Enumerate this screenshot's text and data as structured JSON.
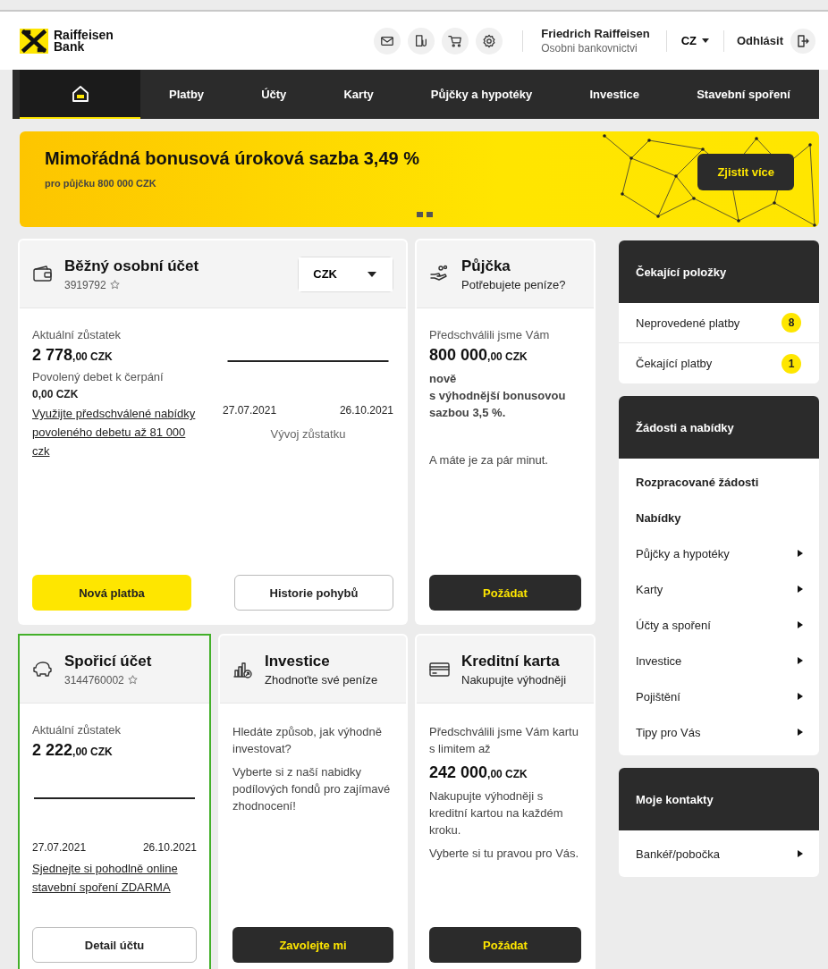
{
  "header": {
    "logo": {
      "line1": "Raiffeisen",
      "line2": "Bank"
    },
    "tools": [
      {
        "kind": "mail"
      },
      {
        "kind": "document"
      },
      {
        "kind": "cart"
      },
      {
        "kind": "settings"
      }
    ],
    "user": {
      "name": "Friedrich Raiffeisen",
      "subtitle": "Osobni bankovnictvi"
    },
    "language": "CZ",
    "logout": "Odhlásit"
  },
  "nav": [
    {
      "kind": "home",
      "selected": true
    },
    {
      "kind": "link",
      "label": "Platby",
      "selected": false
    },
    {
      "kind": "link",
      "label": "Účty",
      "selected": false
    },
    {
      "kind": "link",
      "label": "Karty",
      "selected": false
    },
    {
      "kind": "link",
      "label": "Půjčky a hypotéky",
      "selected": false
    },
    {
      "kind": "link",
      "label": "Investice",
      "selected": false
    },
    {
      "kind": "link",
      "label": "Stavební spoření",
      "selected": false
    }
  ],
  "banner": {
    "title": "Mimořádná bonusová úroková sazba 3,49 %",
    "subtitle": "pro půjčku 800 000 CZK",
    "button": "Zjistit více"
  },
  "cards": [
    {
      "kind": "wide",
      "title": "Běžný osobní účet",
      "number": "3919792",
      "favorite": false,
      "currency": "CZK",
      "selected": false,
      "columns": [
        [
          {
            "kind": "label",
            "text": "Aktuální zůstatek"
          },
          {
            "kind": "amount",
            "main": "2 778",
            "decimals": ",00 CZK"
          },
          {
            "kind": "label",
            "text": "Povolený debet k čerpání"
          },
          {
            "kind": "value",
            "text": "0,00 CZK"
          },
          {
            "kind": "link",
            "text": "Využijte předschválené nabídky povoleného debetu až 81 000 czk"
          }
        ],
        [
          {
            "kind": "chart",
            "start": "27.07.2021",
            "end": "26.10.2021",
            "caption": "Vývoj zůstatku"
          }
        ]
      ],
      "buttons": [
        {
          "kind": "primary",
          "label": "Nová platba"
        },
        {
          "kind": "outline",
          "label": "Historie pohybů"
        }
      ]
    },
    {
      "kind": "narrow",
      "title": "Půjčka",
      "subtitle": "Potřebujete peníze?",
      "selected": false,
      "blocks": [
        {
          "kind": "label",
          "text": "Předschválili jsme Vám"
        },
        {
          "kind": "amount",
          "main": "800 000",
          "decimals": ",00 CZK"
        },
        {
          "kind": "bold",
          "text": "nově"
        },
        {
          "kind": "bold",
          "text": "s výhodnější bonusovou sazbou 3,5 %."
        },
        {
          "kind": "gap"
        },
        {
          "kind": "text",
          "text": "A máte je za pár minut."
        }
      ],
      "buttons": [
        {
          "kind": "dark",
          "label": "Požádat"
        }
      ]
    },
    {
      "kind": "narrow",
      "title": "Spořicí účet",
      "number": "3144760002",
      "favorite": false,
      "selected": true,
      "blocks": [
        {
          "kind": "label",
          "text": "Aktuální zůstatek"
        },
        {
          "kind": "amount",
          "main": "2 222",
          "decimals": ",00 CZK"
        },
        {
          "kind": "chart",
          "start": "27.07.2021",
          "end": "26.10.2021"
        },
        {
          "kind": "link",
          "text": "Sjednejte si pohodlně online stavební spoření ZDARMA"
        }
      ],
      "buttons": [
        {
          "kind": "outline",
          "label": "Detail účtu"
        }
      ]
    },
    {
      "kind": "narrow",
      "title": "Investice",
      "subtitle": "Zhodnoťte své peníze",
      "selected": false,
      "blocks": [
        {
          "kind": "text",
          "text": "Hledáte způsob, jak výhodně investovat?"
        },
        {
          "kind": "text",
          "text": "Vyberte si z naší nabidky podílových fondů pro zajímavé zhodnocení!"
        }
      ],
      "buttons": [
        {
          "kind": "dark",
          "label": "Zavolejte mi"
        }
      ]
    },
    {
      "kind": "narrow",
      "title": "Kreditní karta",
      "subtitle": "Nakupujte výhodněji",
      "selected": false,
      "blocks": [
        {
          "kind": "text",
          "text": "Předschválili jsme Vám kartu s limitem až"
        },
        {
          "kind": "amount",
          "main": "242 000",
          "decimals": ",00 CZK"
        },
        {
          "kind": "text",
          "text": "Nakupujte výhodněji s kreditní kartou na každém kroku."
        },
        {
          "kind": "text",
          "text": "Vyberte si tu pravou pro Vás."
        }
      ],
      "buttons": [
        {
          "kind": "dark",
          "label": "Požádat"
        }
      ]
    }
  ],
  "sidebar": [
    {
      "title": "Čekající položky",
      "items": [
        {
          "kind": "count",
          "label": "Neprovedené platby",
          "count": "8"
        },
        {
          "kind": "count",
          "label": "Čekající platby",
          "count": "1"
        }
      ]
    },
    {
      "title": "Žádosti a nabídky",
      "items": [
        {
          "kind": "heading",
          "label": "Rozpracované žádosti"
        },
        {
          "kind": "heading",
          "label": "Nabídky"
        },
        {
          "kind": "arrow",
          "label": "Půjčky a hypotéky"
        },
        {
          "kind": "arrow",
          "label": "Karty"
        },
        {
          "kind": "arrow",
          "label": "Účty a spoření"
        },
        {
          "kind": "arrow",
          "label": "Investice"
        },
        {
          "kind": "arrow",
          "label": "Pojištění"
        },
        {
          "kind": "arrow",
          "label": "Tipy pro Vás"
        }
      ]
    },
    {
      "title": "Moje kontakty",
      "items": [
        {
          "kind": "arrow",
          "label": "Bankéř/pobočka"
        }
      ]
    }
  ]
}
